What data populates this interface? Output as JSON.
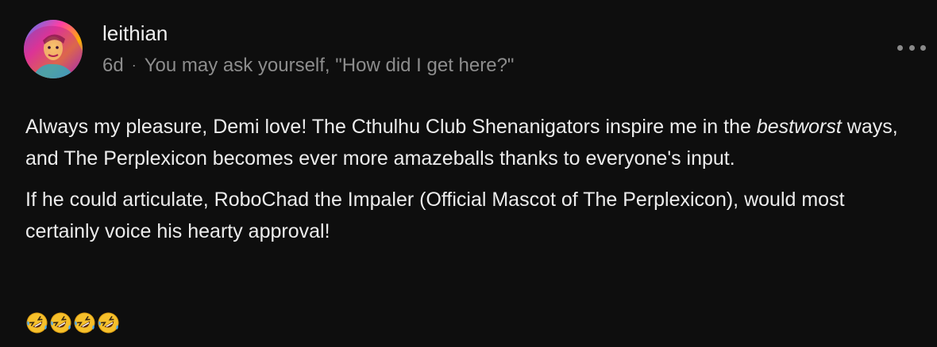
{
  "comment": {
    "username": "leithian",
    "age": "6d",
    "separator": "·",
    "tagline": "You may ask yourself, \"How did I get here?\"",
    "paragraph1_start": "Always my pleasure, Demi love! The Cthulhu Club Shenanigators inspire me in the ",
    "paragraph1_emphasis": "bestworst",
    "paragraph1_end": " ways, and The Perplexicon becomes ever more amazeballs thanks to everyone's input.",
    "paragraph2": "If he could articulate, RoboChad the Impaler (Official Mascot of The Perplexicon), would most certainly voice his hearty approval!",
    "reactions": [
      "rolling-on-floor-laughing",
      "rolling-on-floor-laughing",
      "rolling-on-floor-laughing",
      "rolling-on-floor-laughing"
    ]
  },
  "icons": {
    "more": "more-horizontal-icon",
    "avatar": "user-avatar"
  },
  "colors": {
    "background": "#0e0e0e",
    "text": "#ececec",
    "muted": "#8d8d8d"
  }
}
